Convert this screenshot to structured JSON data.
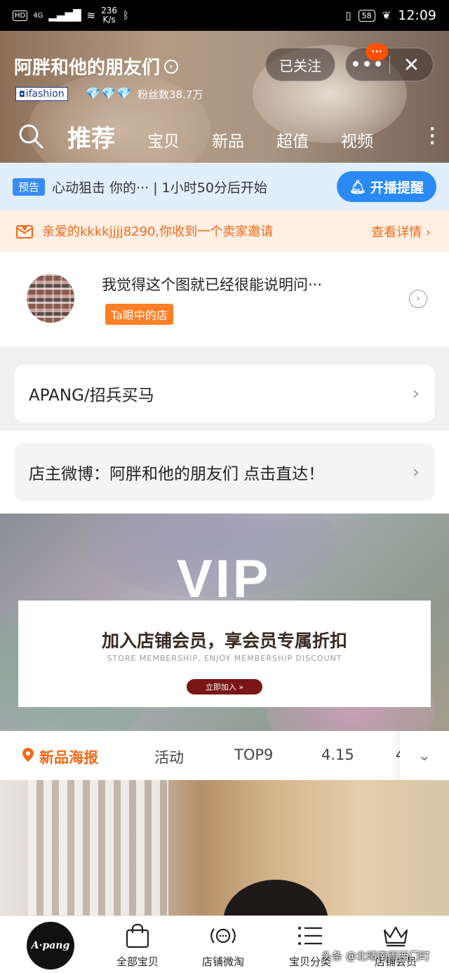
{
  "status_bar": {
    "hd": "HD",
    "network": "4G",
    "speed_value": "236",
    "speed_unit": "K/s",
    "battery": "58",
    "time": "12:09"
  },
  "header": {
    "shop_name": "阿胖和他的朋友们",
    "follow_label": "已关注",
    "more_badge": "···",
    "ifashion_badge": "ifashion",
    "diamonds": "💎💎💎",
    "fans": "粉丝数38.7万",
    "nav": [
      "推荐",
      "宝贝",
      "新品",
      "超值",
      "视频"
    ]
  },
  "preview": {
    "tag": "预告",
    "text": "心动狙击 你的··· | 1小时50分后开始",
    "remind_label": "开播提醒"
  },
  "invite": {
    "message": "亲爱的kkkkjjjj8290,你收到一个卖家邀请",
    "detail_label": "查看详情 ›"
  },
  "recommend": {
    "title": "我觉得这个图就已经很能说明问···",
    "tag": "Ta眼中的店"
  },
  "cards": {
    "apang": "APANG/招兵买马",
    "weibo": "店主微博：阿胖和他的朋友们 点击直达！"
  },
  "vip_banner": {
    "word": "VIP",
    "headline": "加入店铺会员，享会员专属折扣",
    "subline": "STORE MEMBERSHIP, ENJOY MEMBERSHIP DISCOUNT",
    "button": "立即加入 »"
  },
  "categories": {
    "items": [
      "新品海报",
      "活动",
      "TOP9",
      "4.15",
      "4"
    ]
  },
  "bottom_bar": {
    "logo": "A·pang",
    "tabs": [
      "全部宝贝",
      "店铺微淘",
      "宝贝分类",
      "店铺会员"
    ]
  },
  "watermark": "头条 @北晴南雨西门町",
  "colors": {
    "accent_orange": "#f06a1c",
    "accent_blue": "#2a8af5",
    "badge_orange": "#ff5000"
  }
}
